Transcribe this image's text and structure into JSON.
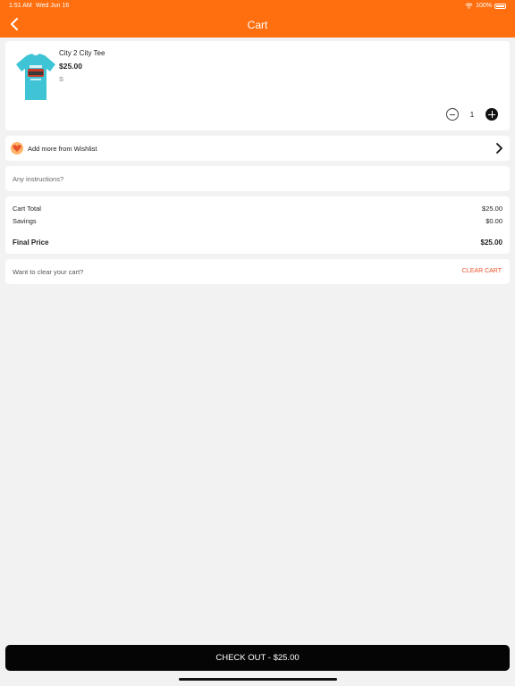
{
  "status_bar": {
    "time": "1:51 AM",
    "date": "Wed Jun 16",
    "battery": "100%"
  },
  "header": {
    "title": "Cart",
    "back_icon": "chevron-left-icon"
  },
  "cart_item": {
    "name": "City 2 City Tee",
    "price": "$25.00",
    "size": "S",
    "quantity": "1",
    "image": "tshirt-icon",
    "shirt_color": "#3fc4d6"
  },
  "wishlist": {
    "label": "Add more from Wishlist",
    "icon": "heart-icon"
  },
  "instructions": {
    "placeholder": "Any instructions?"
  },
  "summary": {
    "cart_total_label": "Cart Total",
    "cart_total_value": "$25.00",
    "savings_label": "Savings",
    "savings_value": "$0.00",
    "final_price_label": "Final Price",
    "final_price_value": "$25.00"
  },
  "clear": {
    "prompt": "Want to clear your cart?",
    "button": "CLEAR CART"
  },
  "checkout": {
    "label": "CHECK OUT - $25.00"
  },
  "colors": {
    "accent": "#ff6f0f",
    "clear_cart": "#e8542a",
    "checkout_bg": "#050505"
  }
}
